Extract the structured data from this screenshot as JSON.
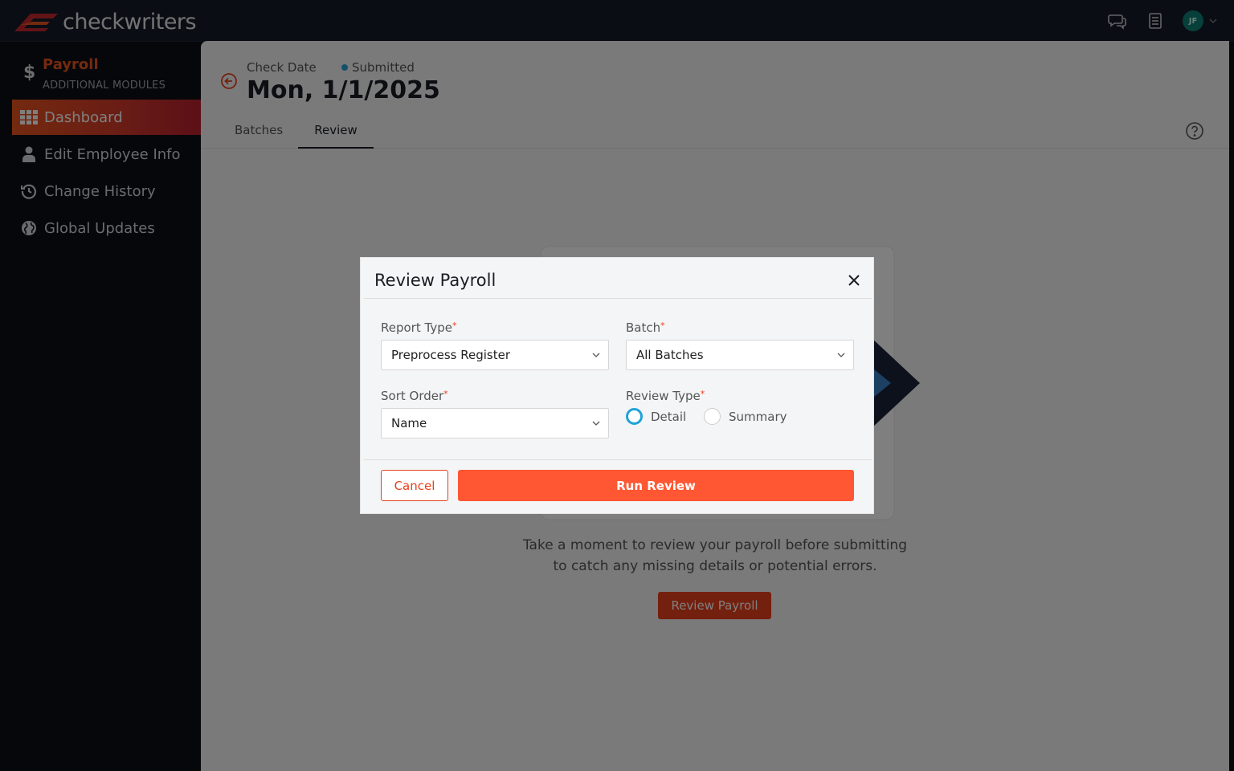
{
  "app": {
    "logo_text": "checkwriters",
    "avatar_initials": "JF",
    "brand_color": "#e8401c"
  },
  "topbar": {
    "icons": [
      "chat-icon",
      "document-list-icon",
      "avatar",
      "chevron-down-icon"
    ]
  },
  "sidebar": {
    "module_title": "Payroll",
    "module_subtitle": "ADDITIONAL MODULES",
    "items": [
      {
        "label": "Dashboard",
        "icon": "grid-icon",
        "active": true
      },
      {
        "label": "Edit Employee Info",
        "icon": "person-icon",
        "active": false
      },
      {
        "label": "Change History",
        "icon": "history-icon",
        "active": false
      },
      {
        "label": "Global Updates",
        "icon": "globe-icon",
        "active": false
      }
    ]
  },
  "header": {
    "check_date_label": "Check Date",
    "status": "Submitted",
    "check_date": "Mon, 1/1/2025"
  },
  "tabs": [
    {
      "label": "Batches",
      "active": false
    },
    {
      "label": "Review",
      "active": true
    }
  ],
  "empty_state": {
    "message": "Take a moment to review your payroll before submitting to catch any missing details or potential errors.",
    "button_label": "Review Payroll"
  },
  "modal": {
    "title": "Review Payroll",
    "report_type": {
      "label": "Report Type",
      "value": "Preprocess Register"
    },
    "batch": {
      "label": "Batch",
      "value": "All Batches"
    },
    "sort_order": {
      "label": "Sort Order",
      "value": "Name"
    },
    "review_type": {
      "label": "Review Type",
      "options": [
        {
          "label": "Detail",
          "selected": true
        },
        {
          "label": "Summary",
          "selected": false
        }
      ]
    },
    "cancel_label": "Cancel",
    "run_label": "Run Review"
  }
}
